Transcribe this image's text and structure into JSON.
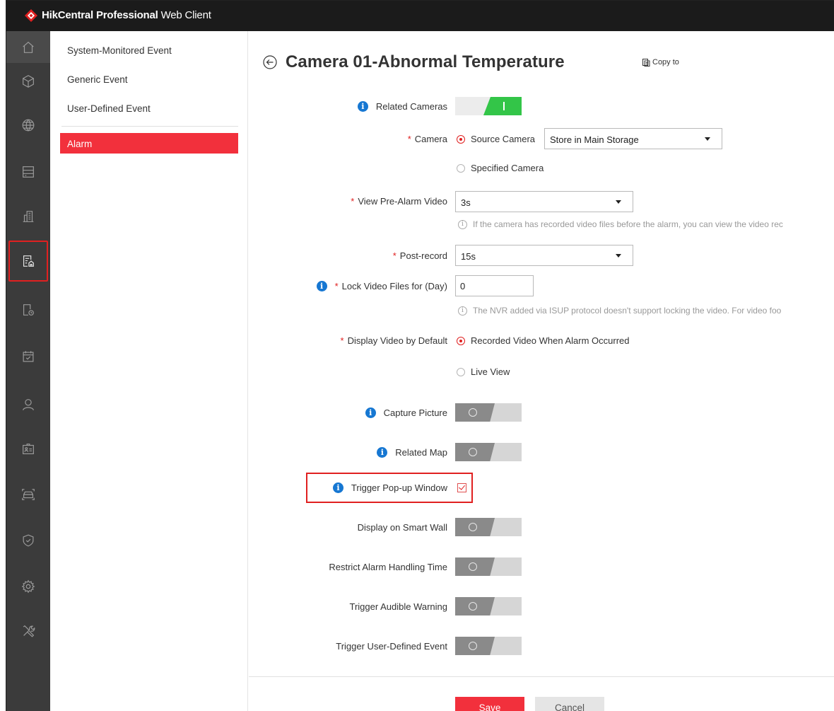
{
  "app": {
    "title_bold": "HikCentral Professional",
    "title_light": "Web Client"
  },
  "nav": {
    "icons": [
      "home-icon",
      "cube-icon",
      "globe-icon",
      "server-icon",
      "building-icon",
      "event-rule-icon",
      "record-schedule-icon",
      "calendar-icon",
      "person-icon",
      "id-card-icon",
      "vehicle-icon",
      "shield-icon",
      "gear-icon",
      "tools-icon"
    ]
  },
  "subnav": {
    "items": [
      "System-Monitored Event",
      "Generic Event",
      "User-Defined Event"
    ],
    "active": "Alarm"
  },
  "page": {
    "title": "Camera 01-Abnormal Temperature",
    "copy_to": "Copy to"
  },
  "form": {
    "related_cameras": {
      "label": "Related Cameras",
      "on": true
    },
    "camera": {
      "label": "Camera",
      "opt_source": "Source Camera",
      "storage_value": "Store in Main Storage",
      "opt_specified": "Specified Camera"
    },
    "pre_alarm": {
      "label": "View Pre-Alarm Video",
      "value": "3s",
      "hint": "If the camera has recorded video files before the alarm, you can view the video rec"
    },
    "post_record": {
      "label": "Post-record",
      "value": "15s"
    },
    "lock_video": {
      "label": "Lock Video Files for (Day)",
      "value": "0",
      "hint": "The NVR added via ISUP protocol doesn't support locking the video. For video foo"
    },
    "display_video": {
      "label": "Display Video by Default",
      "opt_recorded": "Recorded Video When Alarm Occurred",
      "opt_live": "Live View"
    },
    "capture_picture": {
      "label": "Capture Picture",
      "on": false
    },
    "related_map": {
      "label": "Related Map",
      "on": false
    },
    "popup": {
      "label": "Trigger Pop-up Window",
      "checked": true
    },
    "smart_wall": {
      "label": "Display on Smart Wall",
      "on": false
    },
    "restrict_time": {
      "label": "Restrict Alarm Handling Time",
      "on": false
    },
    "audible": {
      "label": "Trigger Audible Warning",
      "on": false
    },
    "user_defined": {
      "label": "Trigger User-Defined Event",
      "on": false
    }
  },
  "footer": {
    "save": "Save",
    "cancel": "Cancel"
  },
  "colors": {
    "accent": "#f2303c",
    "toggle_on": "#33c548",
    "info": "#1677d2",
    "topbar": "#1b1b1b",
    "nav_bg": "#3b3b3b"
  }
}
